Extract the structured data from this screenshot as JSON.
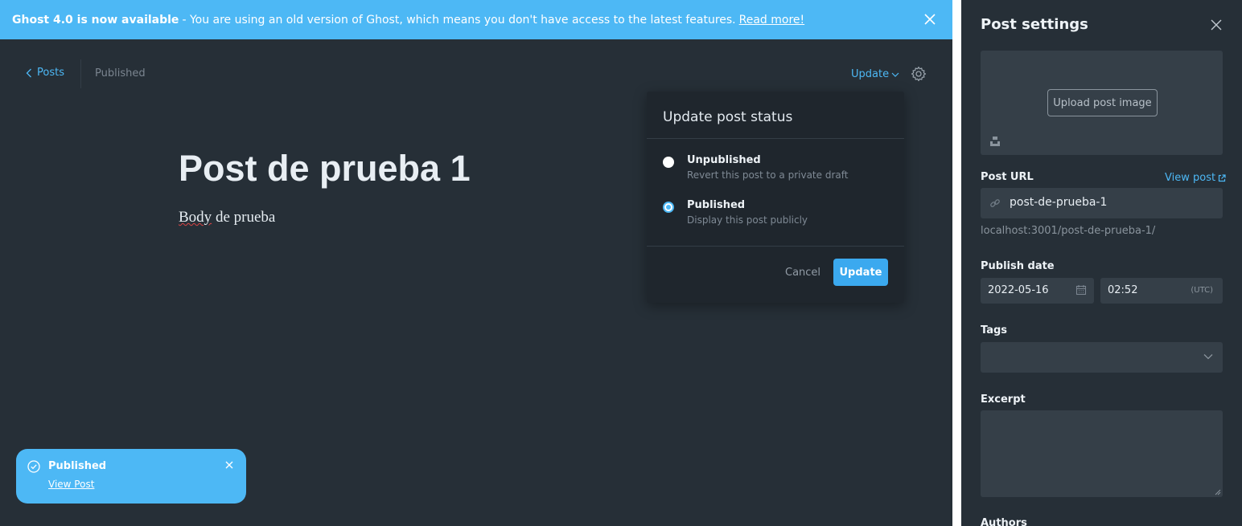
{
  "banner": {
    "bold": "Ghost 4.0 is now available",
    "text": "- You are using an old version of Ghost, which means you don't have access to the latest features.",
    "link": "Read more!"
  },
  "editor": {
    "back_label": "Posts",
    "status": "Published",
    "update_label": "Update",
    "title": "Post de prueba 1",
    "body_word1": "Body",
    "body_rest": " de prueba"
  },
  "popover": {
    "title": "Update post status",
    "options": [
      {
        "label": "Unpublished",
        "desc": "Revert this post to a private draft",
        "selected": false
      },
      {
        "label": "Published",
        "desc": "Display this post publicly",
        "selected": true
      }
    ],
    "cancel": "Cancel",
    "update": "Update"
  },
  "toast": {
    "title": "Published",
    "link": "View Post"
  },
  "settings": {
    "title": "Post settings",
    "upload_label": "Upload post image",
    "url_label": "Post URL",
    "view_post": "View post",
    "slug": "post-de-prueba-1",
    "url_help": "localhost:3001/post-de-prueba-1/",
    "publish_label": "Publish date",
    "date": "2022-05-16",
    "time": "02:52",
    "tz": "(UTC)",
    "tags_label": "Tags",
    "excerpt_label": "Excerpt",
    "authors_label": "Authors"
  },
  "colors": {
    "accent": "#4db8f5",
    "background": "#262f37",
    "field": "#353f48"
  }
}
